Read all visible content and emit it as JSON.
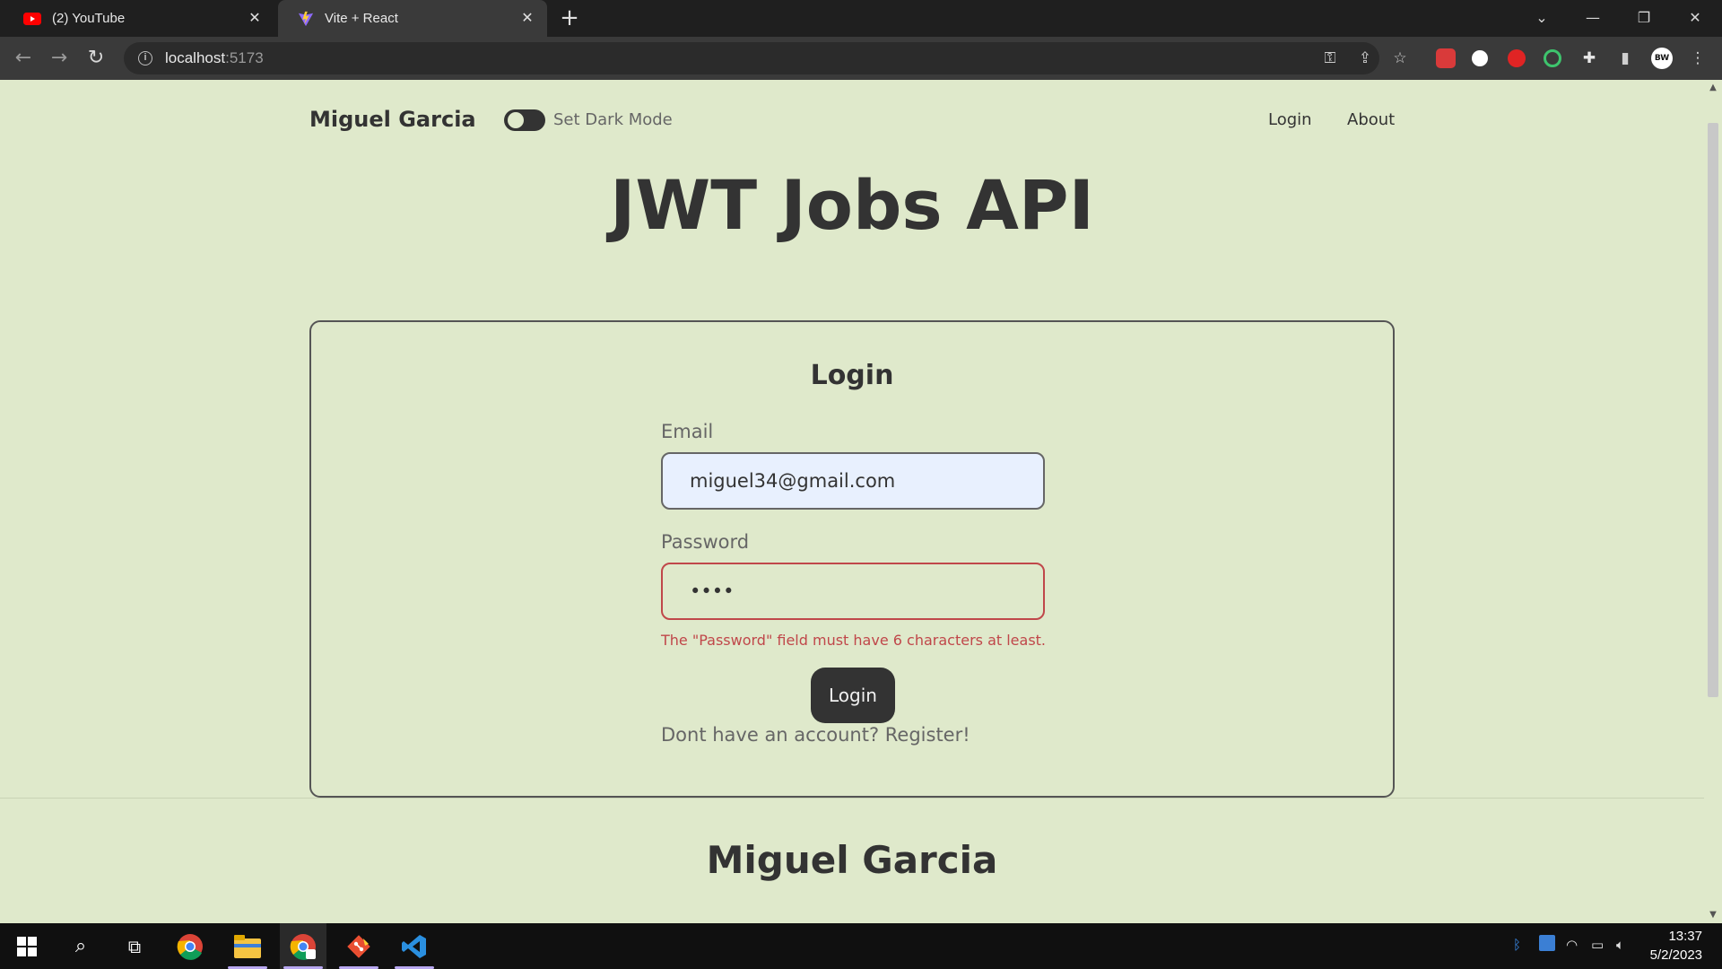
{
  "browser": {
    "tabs": [
      {
        "title": "(2) YouTube",
        "active": false,
        "favicon": "youtube-icon"
      },
      {
        "title": "Vite + React",
        "active": true,
        "favicon": "vite-icon"
      }
    ],
    "url_host": "localhost",
    "url_port": ":5173"
  },
  "navbar": {
    "brand": "Miguel Garcia",
    "dark_mode_label": "Set Dark Mode",
    "links": [
      "Login",
      "About"
    ]
  },
  "hero_title": "JWT Jobs API",
  "login_form": {
    "title": "Login",
    "email_label": "Email",
    "email_value": "miguel34@gmail.com",
    "password_label": "Password",
    "password_value": "••••",
    "error": "The \"Password\" field must have 6 characters at least.",
    "submit_label": "Login",
    "register_text": "Dont have an account? Register!"
  },
  "footer": {
    "name": "Miguel Garcia"
  },
  "taskbar": {
    "time": "13:37",
    "date": "5/2/2023"
  },
  "colors": {
    "page_bg": "#dfe9cb",
    "text": "#333333",
    "error": "#c0474a",
    "autofill_bg": "#e8f0fe"
  }
}
